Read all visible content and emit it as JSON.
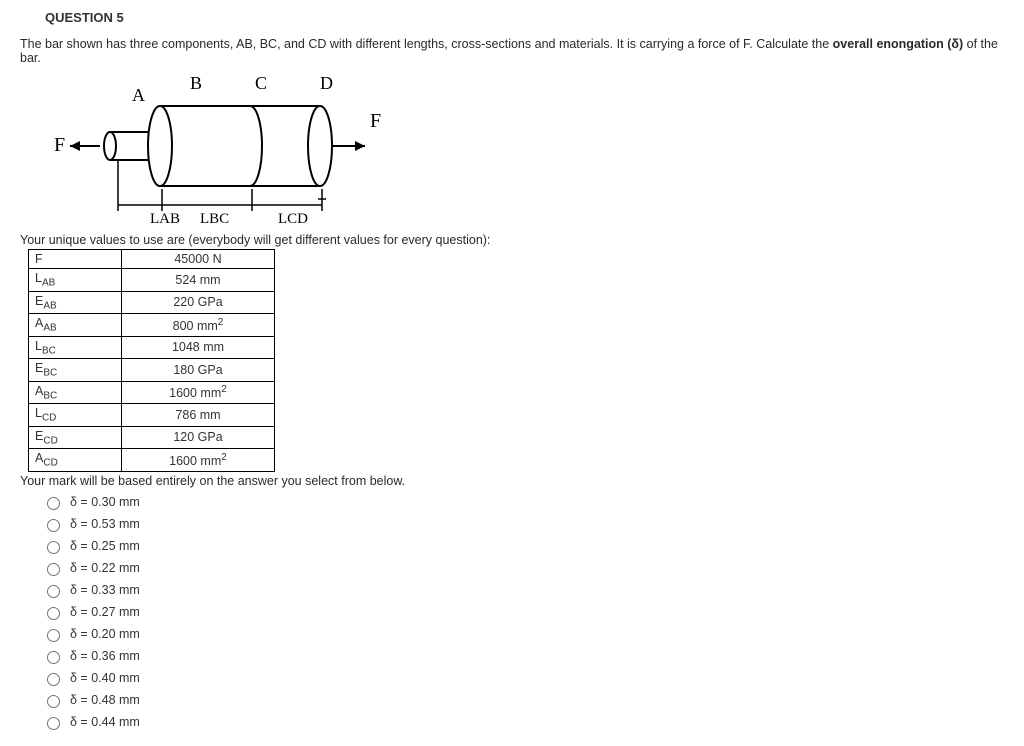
{
  "question_header": "QUESTION 5",
  "prompt_pre": "The bar shown has three components, AB, BC, and CD with different lengths, cross-sections and materials.  It is carrying a force of F.  Calculate the ",
  "prompt_bold": "overall enongation (δ)",
  "prompt_post": " of the bar.",
  "diagram": {
    "A": "A",
    "B": "B",
    "C": "C",
    "D": "D",
    "F_left": "F",
    "F_right": "F",
    "LAB": "LAB",
    "LBC": "LBC",
    "LCD": "LCD"
  },
  "unique_values_text": "Your unique values to use are (everybody will get different values for every question):",
  "table": [
    {
      "name_html": "F",
      "val_html": "45000 N"
    },
    {
      "name_html": "L<span class='sub'>AB</span>",
      "val_html": "524 mm"
    },
    {
      "name_html": "E<span class='sub'>AB</span>",
      "val_html": "220 GPa"
    },
    {
      "name_html": "A<span class='sub'>AB</span>",
      "val_html": "800 mm<span class='sup'>2</span>"
    },
    {
      "name_html": "L<span class='sub'>BC</span>",
      "val_html": "1048 mm"
    },
    {
      "name_html": "E<span class='sub'>BC</span>",
      "val_html": "180 GPa"
    },
    {
      "name_html": "A<span class='sub'>BC</span>",
      "val_html": "1600 mm<span class='sup'>2</span>"
    },
    {
      "name_html": "L<span class='sub'>CD</span>",
      "val_html": "786 mm"
    },
    {
      "name_html": "E<span class='sub'>CD</span>",
      "val_html": "120 GPa"
    },
    {
      "name_html": "A<span class='sub'>CD</span>",
      "val_html": "1600 mm<span class='sup'>2</span>"
    }
  ],
  "mark_text": "Your mark will be based entirely on the answer you select from below.",
  "options": [
    "δ = 0.30 mm",
    "δ = 0.53 mm",
    "δ = 0.25 mm",
    "δ = 0.22 mm",
    "δ = 0.33 mm",
    "δ = 0.27 mm",
    "δ = 0.20 mm",
    "δ = 0.36 mm",
    "δ = 0.40 mm",
    "δ = 0.48 mm",
    "δ = 0.44 mm"
  ]
}
